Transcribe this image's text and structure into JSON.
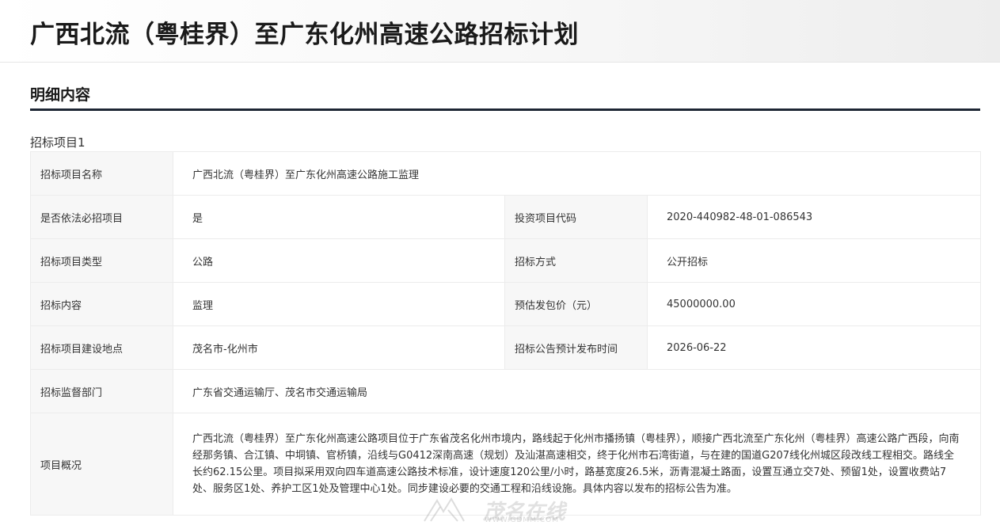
{
  "page": {
    "title": "广西北流（粤桂界）至广东化州高速公路招标计划"
  },
  "section": {
    "title": "明细内容",
    "project_label": "招标项目1"
  },
  "rows": {
    "name": {
      "label": "招标项目名称",
      "value": "广西北流（粤桂界）至广东化州高速公路施工监理"
    },
    "mandatory": {
      "label": "是否依法必招项目",
      "value": "是"
    },
    "invest_code": {
      "label": "投资项目代码",
      "value": "2020-440982-48-01-086543"
    },
    "type": {
      "label": "招标项目类型",
      "value": "公路"
    },
    "method": {
      "label": "招标方式",
      "value": "公开招标"
    },
    "content": {
      "label": "招标内容",
      "value": "监理"
    },
    "estimate": {
      "label": "预估发包价（元）",
      "value": "45000000.00"
    },
    "location": {
      "label": "招标项目建设地点",
      "value": "茂名市-化州市"
    },
    "publish_time": {
      "label": "招标公告预计发布时间",
      "value": "2026-06-22"
    },
    "supervisor": {
      "label": "招标监督部门",
      "value": "广东省交通运输厅、茂名市交通运输局"
    },
    "overview": {
      "label": "项目概况",
      "value": "广西北流（粤桂界）至广东化州高速公路项目位于广东省茂名化州市境内，路线起于化州市播扬镇（粤桂界），顺接广西北流至广东化州（粤桂界）高速公路广西段，向南经那务镇、合江镇、中垌镇、官桥镇，沿线与G0412深南高速（规划）及汕湛高速相交，终于化州市石湾街道，与在建的国道G207线化州城区段改线工程相交。路线全长约62.15公里。项目拟采用双向四车道高速公路技术标准，设计速度120公里/小时，路基宽度26.5米，沥青混凝土路面，设置互通立交7处、预留1处，设置收费站7处、服务区1处、养护工区1处及管理中心1处。同步建设必要的交通工程和沿线设施。具体内容以发布的招标公告为准。"
    }
  },
  "watermark": {
    "text": "茂名在线",
    "url": "WWW.GDMM.COM"
  }
}
